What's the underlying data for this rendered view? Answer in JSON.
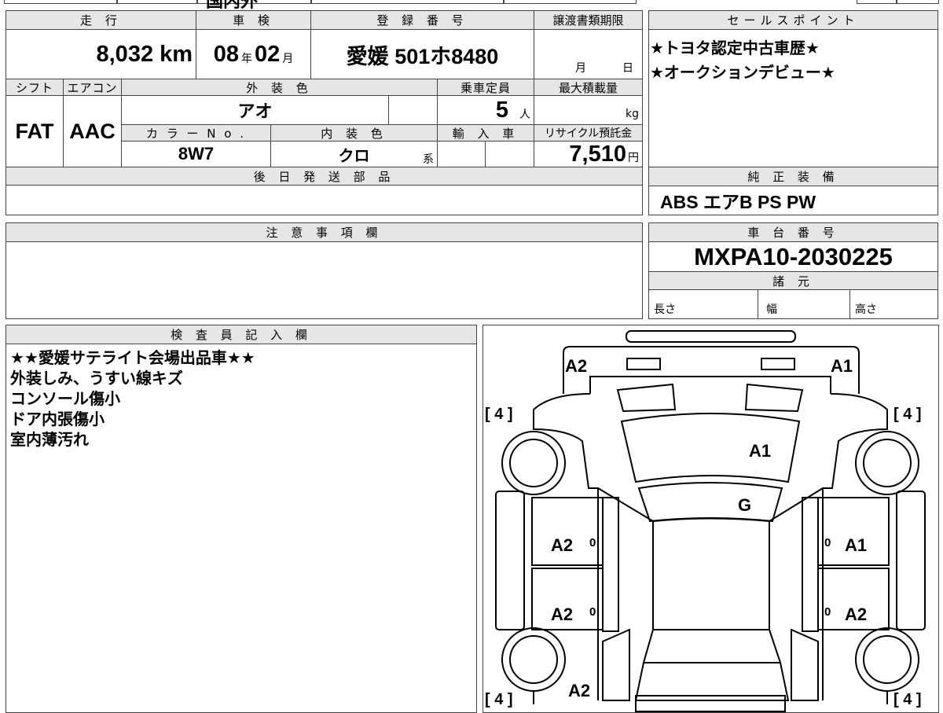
{
  "top_fragment": "国内外",
  "vehicle": {
    "headers": {
      "mileage": "走 行",
      "inspection": "車 検",
      "registration": "登 録 番 号",
      "transfer_deadline": "譲渡書類期限",
      "shift": "シフト",
      "aircon": "エアコン",
      "exterior_color": "外 装 色",
      "capacity": "乗車定員",
      "max_load": "最大積載量",
      "color_no": "カ ラ ー N o .",
      "interior_color": "内 装 色",
      "import": "輸 入 車",
      "recycle_fee": "リサイクル預託金",
      "later_parts": "後 日 発 送 部 品"
    },
    "mileage_value": "8,032",
    "mileage_unit": "km",
    "inspection_year": "08",
    "inspection_year_unit": "年",
    "inspection_month": "02",
    "inspection_month_unit": "月",
    "registration_number": "愛媛 501ホ8480",
    "deadline_month_unit": "月",
    "deadline_day_unit": "日",
    "shift_value": "FAT",
    "aircon_value": "AAC",
    "exterior_color_value": "アオ",
    "capacity_value": "5",
    "capacity_unit": "人",
    "max_load_unit": "kg",
    "color_no_value": "8W7",
    "interior_color_value": "クロ",
    "interior_color_suffix": "系",
    "recycle_fee_value": "7,510",
    "recycle_fee_unit": "円"
  },
  "sales_points": {
    "header": "セールスポイント",
    "lines": [
      "★トヨタ認定中古車歴★",
      "★オークションデビュー★"
    ]
  },
  "equipment": {
    "header": "純 正 装 備",
    "value": "ABS エアB PS PW"
  },
  "notes": {
    "header": "注 意 事 項 欄"
  },
  "chassis": {
    "header": "車 台 番 号",
    "value": "MXPA10-2030225",
    "specs_header": "諸 元",
    "length_label": "長さ",
    "width_label": "幅",
    "height_label": "高さ"
  },
  "inspector": {
    "header": "検 査 員 記 入 欄",
    "lines": [
      "★★愛媛サテライト会場出品車★★",
      "外装しみ、うすい線キズ",
      "コンソール傷小",
      "ドア内張傷小",
      "室内薄汚れ"
    ]
  },
  "diagram": {
    "marks": {
      "front_left": "A2",
      "front_right": "A1",
      "hood": "A1",
      "windshield": "G",
      "left_front_door": "A2",
      "right_front_door": "A1",
      "left_rear_door": "A2",
      "right_rear_door": "A2",
      "rear_left": "A2",
      "tire_fl": "[ 4 ]",
      "tire_fr": "[ 4 ]",
      "tire_rl": "[ 4 ]",
      "tire_rr": "[ 4 ]",
      "pillar_small_1": "0",
      "pillar_small_2": "0",
      "pillar_small_3": "0",
      "pillar_small_4": "0"
    }
  }
}
